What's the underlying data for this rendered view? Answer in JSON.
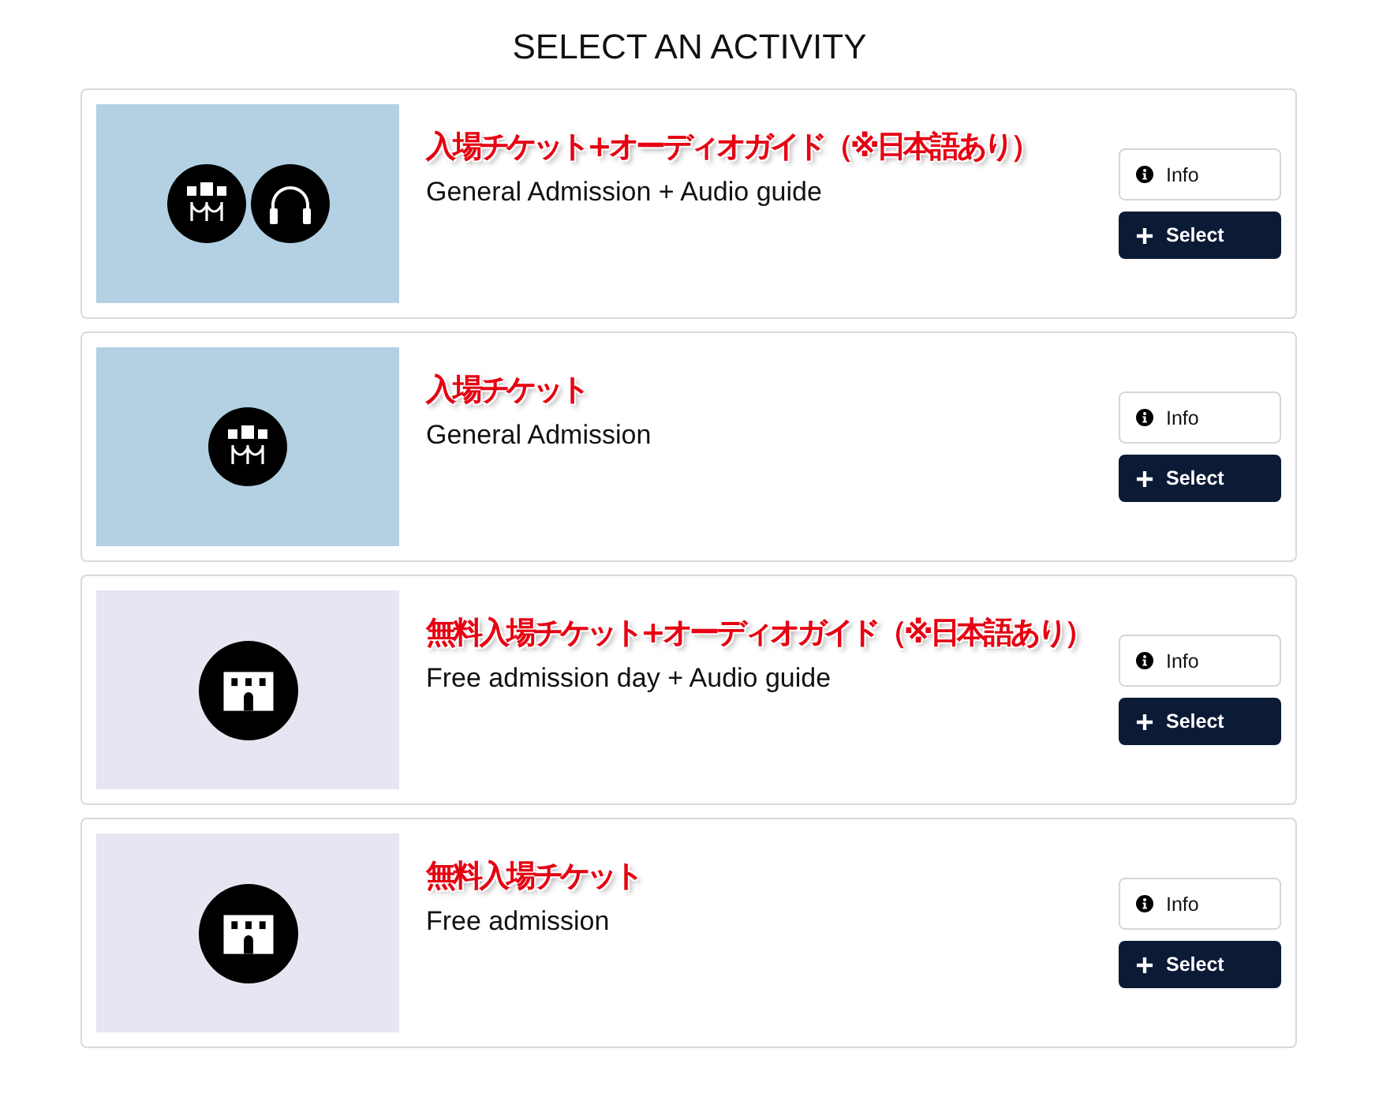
{
  "title": "SELECT AN ACTIVITY",
  "activities": [
    {
      "thumbnail": {
        "color": "#b3d1e2",
        "icons": [
          {
            "kind": "queue"
          },
          {
            "kind": "headphones"
          }
        ]
      },
      "annotation": "入場チケット+オーディオガイド（※日本語あり）",
      "name": "General Admission + Audio guide",
      "info_button": "Info",
      "select_button": "Select"
    },
    {
      "thumbnail": {
        "color": "#b3d1e2",
        "icons": [
          {
            "kind": "queue"
          }
        ]
      },
      "annotation": "入場チケット",
      "name": "General Admission",
      "info_button": "Info",
      "select_button": "Select"
    },
    {
      "thumbnail": {
        "color": "#e6e5f2",
        "icons": [
          {
            "kind": "building"
          }
        ]
      },
      "annotation": "無料入場チケット+オーディオガイド（※日本語あり）",
      "name": "Free admission day + Audio guide",
      "info_button": "Info",
      "select_button": "Select"
    },
    {
      "thumbnail": {
        "color": "#e6e5f2",
        "icons": [
          {
            "kind": "building"
          }
        ]
      },
      "annotation": "無料入場チケット",
      "name": "Free admission",
      "info_button": "Info",
      "select_button": "Select"
    }
  ]
}
